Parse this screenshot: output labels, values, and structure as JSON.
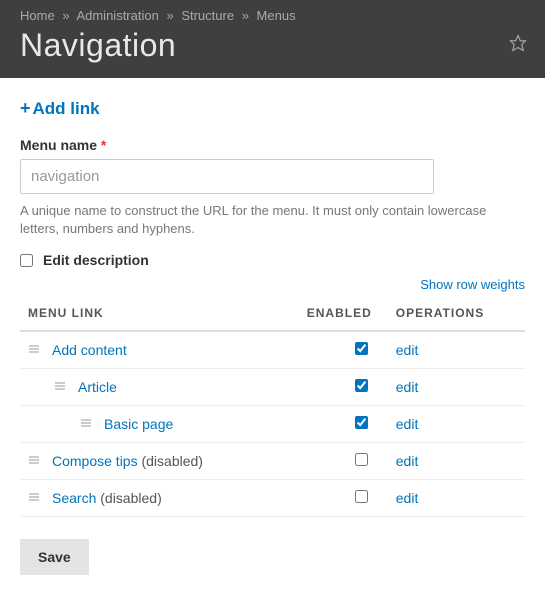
{
  "breadcrumb": [
    "Home",
    "Administration",
    "Structure",
    "Menus"
  ],
  "breadcrumb_sep": "»",
  "page_title": "Navigation",
  "add_link_label": "Add link",
  "menu_name": {
    "label": "Menu name",
    "required_mark": "*",
    "value": "navigation",
    "description": "A unique name to construct the URL for the menu. It must only contain lowercase letters, numbers and hyphens."
  },
  "edit_description_label": "Edit description",
  "show_row_weights_label": "Show row weights",
  "table": {
    "headers": {
      "menu_link": "MENU LINK",
      "enabled": "ENABLED",
      "operations": "OPERATIONS"
    },
    "op_edit": "edit",
    "disabled_suffix": " (disabled)",
    "rows": [
      {
        "name": "Add content",
        "indent": 0,
        "enabled": true,
        "disabled": false
      },
      {
        "name": "Article",
        "indent": 1,
        "enabled": true,
        "disabled": false
      },
      {
        "name": "Basic page",
        "indent": 2,
        "enabled": true,
        "disabled": false
      },
      {
        "name": "Compose tips",
        "indent": 0,
        "enabled": false,
        "disabled": true
      },
      {
        "name": "Search",
        "indent": 0,
        "enabled": false,
        "disabled": true
      }
    ]
  },
  "save_label": "Save"
}
